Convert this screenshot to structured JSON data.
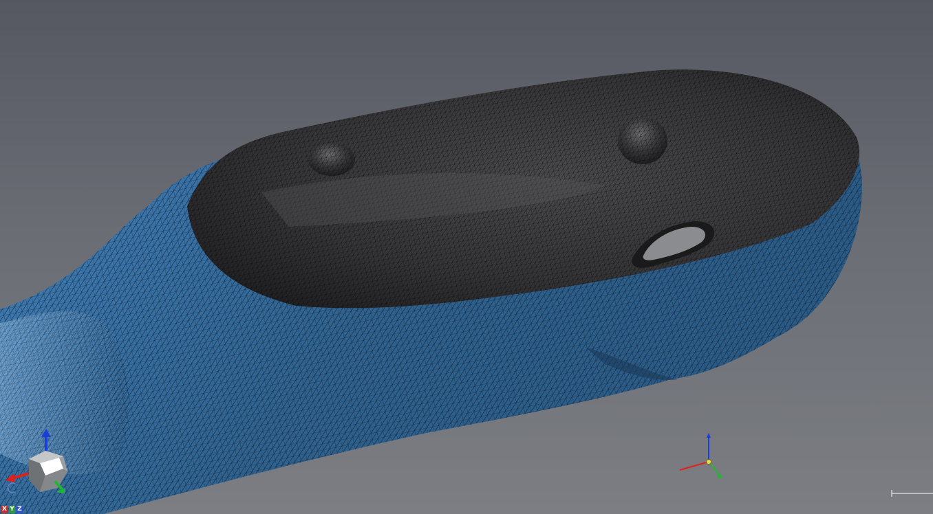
{
  "viewer": {
    "background_top": "#555861",
    "background_bottom": "#7c7e83",
    "mesh_outer_color": "#3b6f9e",
    "mesh_inner_color": "#2e2e30",
    "wireframe_color": "#0a0f14"
  },
  "view_cube": {
    "icon": "view-cube-icon",
    "axis_colors": {
      "x": "#e0201c",
      "y": "#1fb82f",
      "z": "#1a3fd8"
    }
  },
  "axis_buttons": {
    "x": "X",
    "y": "Y",
    "z": "Z",
    "x_color": "#c4302b",
    "y_color": "#2f9a3b",
    "z_color": "#2e56c8"
  },
  "origin_triad": {
    "icon": "coordinate-axes-icon",
    "center_color": "#e8d84a"
  },
  "scale_bar": {
    "icon": "scale-bar-icon"
  }
}
